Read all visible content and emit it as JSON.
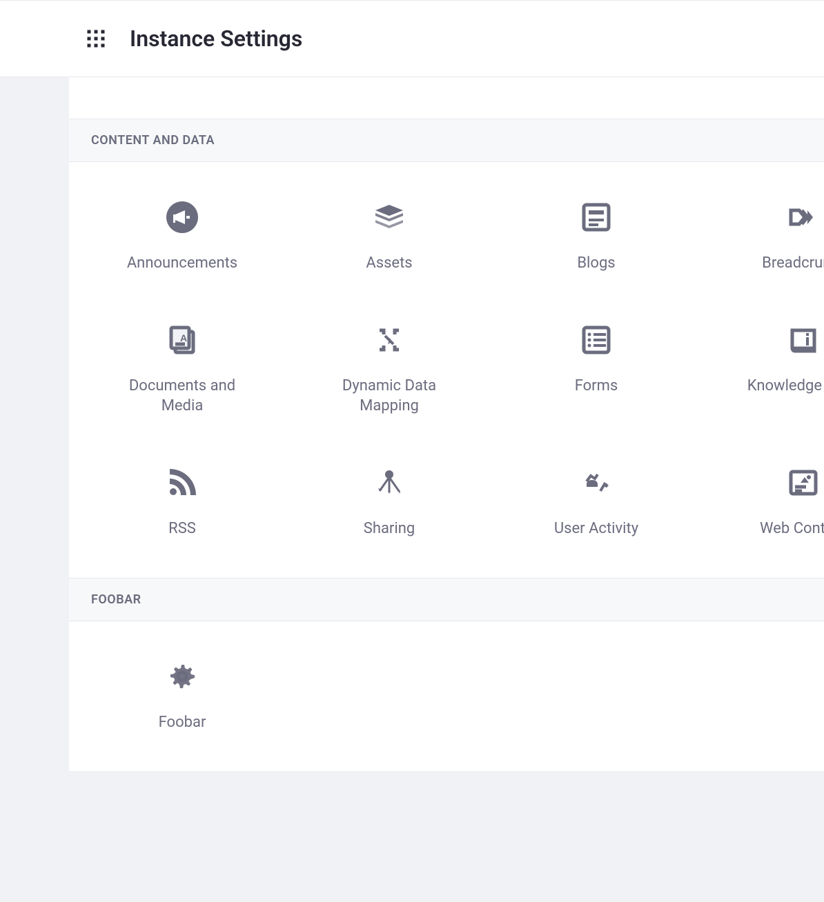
{
  "header": {
    "title": "Instance Settings"
  },
  "sections": [
    {
      "title": "CONTENT AND DATA",
      "items": [
        {
          "label": "Announcements",
          "icon": "megaphone"
        },
        {
          "label": "Assets",
          "icon": "stack"
        },
        {
          "label": "Blogs",
          "icon": "blog"
        },
        {
          "label": "Breadcrumb",
          "icon": "breadcrumb"
        },
        {
          "label": "Documents and Media",
          "icon": "documents"
        },
        {
          "label": "Dynamic Data Mapping",
          "icon": "datamap"
        },
        {
          "label": "Forms",
          "icon": "forms"
        },
        {
          "label": "Knowledge Base",
          "icon": "knowledge"
        },
        {
          "label": "RSS",
          "icon": "rss"
        },
        {
          "label": "Sharing",
          "icon": "sharing"
        },
        {
          "label": "User Activity",
          "icon": "useractivity"
        },
        {
          "label": "Web Content",
          "icon": "webcontent"
        }
      ]
    },
    {
      "title": "FOOBAR",
      "items": [
        {
          "label": "Foobar",
          "icon": "gear"
        }
      ]
    }
  ]
}
